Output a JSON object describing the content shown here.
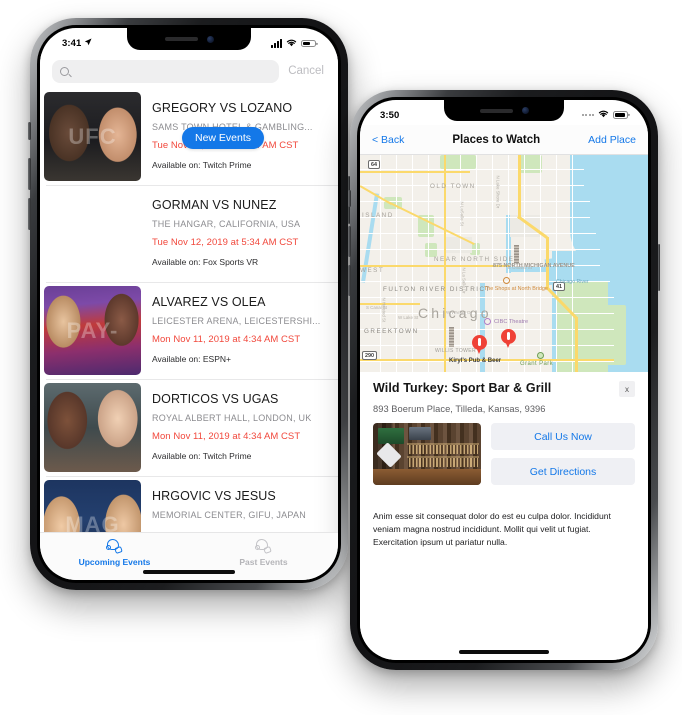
{
  "phone1": {
    "status": {
      "time": "3:41",
      "location_icon": "location-arrow-icon",
      "signal_icon": "signal-bars-icon",
      "wifi_icon": "wifi-icon",
      "battery_icon": "battery-icon"
    },
    "search": {
      "placeholder": "",
      "value": "",
      "icon": "search-icon",
      "cancel_label": "Cancel"
    },
    "badge": {
      "label": "New Events"
    },
    "events": [
      {
        "title": "GREGORY VS LOZANO",
        "venue": "SAMS TOWN HOTEL & GAMBLING...",
        "date": "Tue Nov 12, 2019 at 5:34 AM CST",
        "availability": "Available on: Twitch Prime",
        "thumb": "fighter-faceoff-photo",
        "thumb_class": "ph-a",
        "thumb_text": "UFC"
      },
      {
        "title": "GORMAN VS NUNEZ",
        "venue": "THE HANGAR, CALIFORNIA, USA",
        "date": "Tue Nov 12, 2019 at 5:34 AM CST",
        "availability": "Available on: Fox Sports VR",
        "thumb": "boxers-sparring-photo",
        "thumb_class": "ph-b",
        "thumb_text": ""
      },
      {
        "title": "ALVAREZ VS OLEA",
        "venue": "LEICESTER ARENA, LEICESTERSHI...",
        "date": "Mon Nov 11, 2019 at 4:34 AM CST",
        "availability": "Available on: ESPN+",
        "thumb": "press-conference-photo",
        "thumb_class": "ph-c",
        "thumb_text": "PAY-"
      },
      {
        "title": "DORTICOS VS UGAS",
        "venue": "ROYAL ALBERT HALL, LONDON, UK",
        "date": "Mon Nov 11, 2019 at 4:34 AM CST",
        "availability": "Available on: Twitch Prime",
        "thumb": "boxers-portrait-photo",
        "thumb_class": "ph-d",
        "thumb_text": ""
      },
      {
        "title": "HRGOVIC VS JESUS",
        "venue": "MEMORIAL CENTER, GIFU, JAPAN",
        "date": "",
        "availability": "",
        "thumb": "fighters-stare-photo",
        "thumb_class": "ph-e",
        "thumb_text": "MAG"
      }
    ],
    "tabs": [
      {
        "label": "Upcoming Events",
        "icon": "boxing-glove-icon",
        "active": true
      },
      {
        "label": "Past Events",
        "icon": "boxing-glove-icon",
        "active": false
      }
    ]
  },
  "phone2": {
    "status": {
      "time": "3:50",
      "signal_icon": "signal-dots-icon",
      "wifi_icon": "wifi-icon",
      "battery_icon": "battery-icon"
    },
    "navbar": {
      "back_label": "< Back",
      "title": "Places to Watch",
      "add_label": "Add Place"
    },
    "map": {
      "neighborhoods": [
        "OLD TOWN",
        "NEAR NORTH SIDE",
        "FULTON RIVER DISTRICT",
        "GREEKTOWN",
        "ISLAND",
        "WEST"
      ],
      "city_label": "Chicago",
      "pois": [
        "875 NORTH MICHIGAN AVENUE",
        "The Shops at North Bridge",
        "CIBC Theatre",
        "WILLIS TOWER",
        "Grant Park",
        "Kiryl's Pub & Beer",
        "Chicago River"
      ],
      "streets": [
        "N Lake Shore Dr",
        "N LaSalle St",
        "E Ontario St",
        "N La Salle Dr",
        "W Wacker Dr",
        "W Lake St",
        "N Halsted St",
        "S Canal St",
        "N Lak"
      ],
      "shields": [
        "64",
        "41",
        "290"
      ],
      "pins": 2
    },
    "card": {
      "title": "Wild Turkey: Sport Bar & Grill",
      "address": "893 Boerum Place, Tilleda, Kansas, 9396",
      "close_label": "x",
      "photo": "bar-interior-photo",
      "call_label": "Call Us Now",
      "directions_label": "Get Directions",
      "description": "Anim esse sit consequat dolor do est eu culpa dolor. Incididunt veniam magna nostrud incididunt. Mollit qui velit ut fugiat. Exercitation ipsum ut pariatur nulla."
    }
  },
  "colors": {
    "accent": "#1478e8",
    "date_red": "#f1483c",
    "pin_red": "#ef4136",
    "water": "#a9dcf0",
    "park": "#cfe7bc"
  }
}
